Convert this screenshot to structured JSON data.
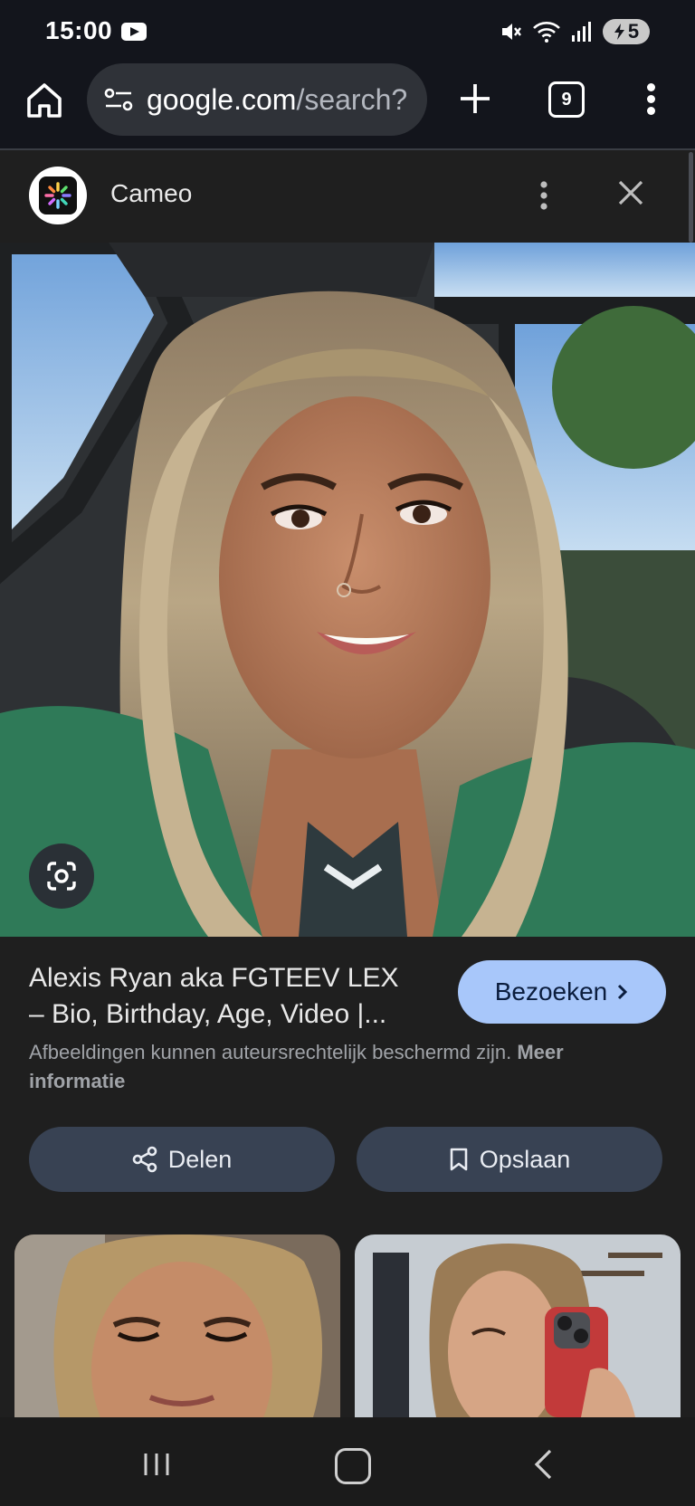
{
  "status_bar": {
    "time": "15:00",
    "battery": "5",
    "icons": [
      "youtube-icon",
      "mute-icon",
      "wifi-icon",
      "signal-icon",
      "battery-charging-icon"
    ]
  },
  "browser": {
    "url_host": "google.com",
    "url_path": "/search?",
    "tab_count": "9",
    "icons": [
      "home-icon",
      "site-info-icon",
      "new-tab-icon",
      "tab-switcher-icon",
      "menu-icon"
    ]
  },
  "source": {
    "name": "Cameo"
  },
  "result": {
    "title_line1": "Alexis Ryan aka FGTEEV LEX",
    "title_line2": "– Bio, Birthday, Age, Video |...",
    "visit_label": "Bezoeken",
    "disclaimer": "Afbeeldingen kunnen auteursrechtelijk beschermd zijn.",
    "more_info_label": "Meer informatie",
    "share_label": "Delen",
    "save_label": "Opslaan"
  },
  "colors": {
    "background": "#1f1f1f",
    "toolbar": "#13151c",
    "visit_button": "#a8c7fa",
    "action_button": "#384253"
  }
}
